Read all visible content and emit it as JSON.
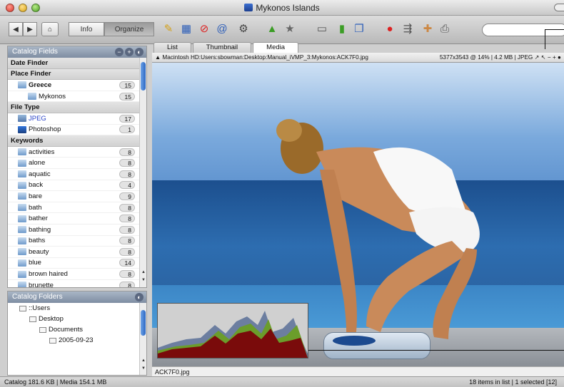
{
  "window": {
    "title": "Mykonos Islands"
  },
  "toolbar": {
    "info_label": "Info",
    "organize_label": "Organize"
  },
  "catalog_fields": {
    "header": "Catalog Fields",
    "rows": [
      {
        "type": "section",
        "label": "Date Finder"
      },
      {
        "type": "section",
        "label": "Place Finder"
      },
      {
        "type": "item",
        "label": "Greece",
        "count": "15",
        "icon": "folder-icon",
        "indent": 0,
        "bold": true
      },
      {
        "type": "item",
        "label": "Mykonos",
        "count": "15",
        "icon": "folder-icon",
        "indent": 1
      },
      {
        "type": "section",
        "label": "File Type"
      },
      {
        "type": "item",
        "label": "JPEG",
        "count": "17",
        "icon": "jpeg-icon",
        "indent": 0,
        "blue": true
      },
      {
        "type": "item",
        "label": "Photoshop",
        "count": "1",
        "icon": "photoshop-icon",
        "indent": 0
      },
      {
        "type": "section",
        "label": "Keywords"
      },
      {
        "type": "item",
        "label": "activities",
        "count": "8",
        "icon": "keyword-icon",
        "indent": 0
      },
      {
        "type": "item",
        "label": "alone",
        "count": "8",
        "icon": "keyword-icon",
        "indent": 0
      },
      {
        "type": "item",
        "label": "aquatic",
        "count": "8",
        "icon": "keyword-icon",
        "indent": 0
      },
      {
        "type": "item",
        "label": "back",
        "count": "4",
        "icon": "keyword-icon",
        "indent": 0
      },
      {
        "type": "item",
        "label": "bare",
        "count": "9",
        "icon": "keyword-icon",
        "indent": 0
      },
      {
        "type": "item",
        "label": "bath",
        "count": "8",
        "icon": "keyword-icon",
        "indent": 0
      },
      {
        "type": "item",
        "label": "bather",
        "count": "8",
        "icon": "keyword-icon",
        "indent": 0
      },
      {
        "type": "item",
        "label": "bathing",
        "count": "8",
        "icon": "keyword-icon",
        "indent": 0
      },
      {
        "type": "item",
        "label": "baths",
        "count": "8",
        "icon": "keyword-icon",
        "indent": 0
      },
      {
        "type": "item",
        "label": "beauty",
        "count": "8",
        "icon": "keyword-icon",
        "indent": 0
      },
      {
        "type": "item",
        "label": "blue",
        "count": "14",
        "icon": "keyword-icon",
        "indent": 0
      },
      {
        "type": "item",
        "label": "brown haired",
        "count": "8",
        "icon": "keyword-icon",
        "indent": 0
      },
      {
        "type": "item",
        "label": "brunette",
        "count": "8",
        "icon": "keyword-icon",
        "indent": 0
      }
    ]
  },
  "catalog_folders": {
    "header": "Catalog Folders",
    "rows": [
      {
        "label": "::Users",
        "indent": 0
      },
      {
        "label": "Desktop",
        "indent": 1
      },
      {
        "label": "Documents",
        "indent": 2
      },
      {
        "label": "2005-09-23",
        "indent": 3
      }
    ]
  },
  "tabs": [
    {
      "label": "List",
      "active": false
    },
    {
      "label": "Thumbnail",
      "active": false
    },
    {
      "label": "Media",
      "active": true
    }
  ],
  "pathbar": {
    "path": "Macintosh HD:Users:sbowman:Desktop:Manual_iVMP_3:Mykonos:ACK7F0.jpg",
    "info": "5377x3543 @ 14%  |  4.2 MB  |  JPEG"
  },
  "media": {
    "caption": "ACK7F0.jpg"
  },
  "status": {
    "left": "Catalog  181.6 KB  |  Media 154.1 MB",
    "right": "18 items in list  |  1 selected [12]"
  },
  "colors": {
    "accent": "#2c68c4",
    "header": "#7e8da2"
  }
}
